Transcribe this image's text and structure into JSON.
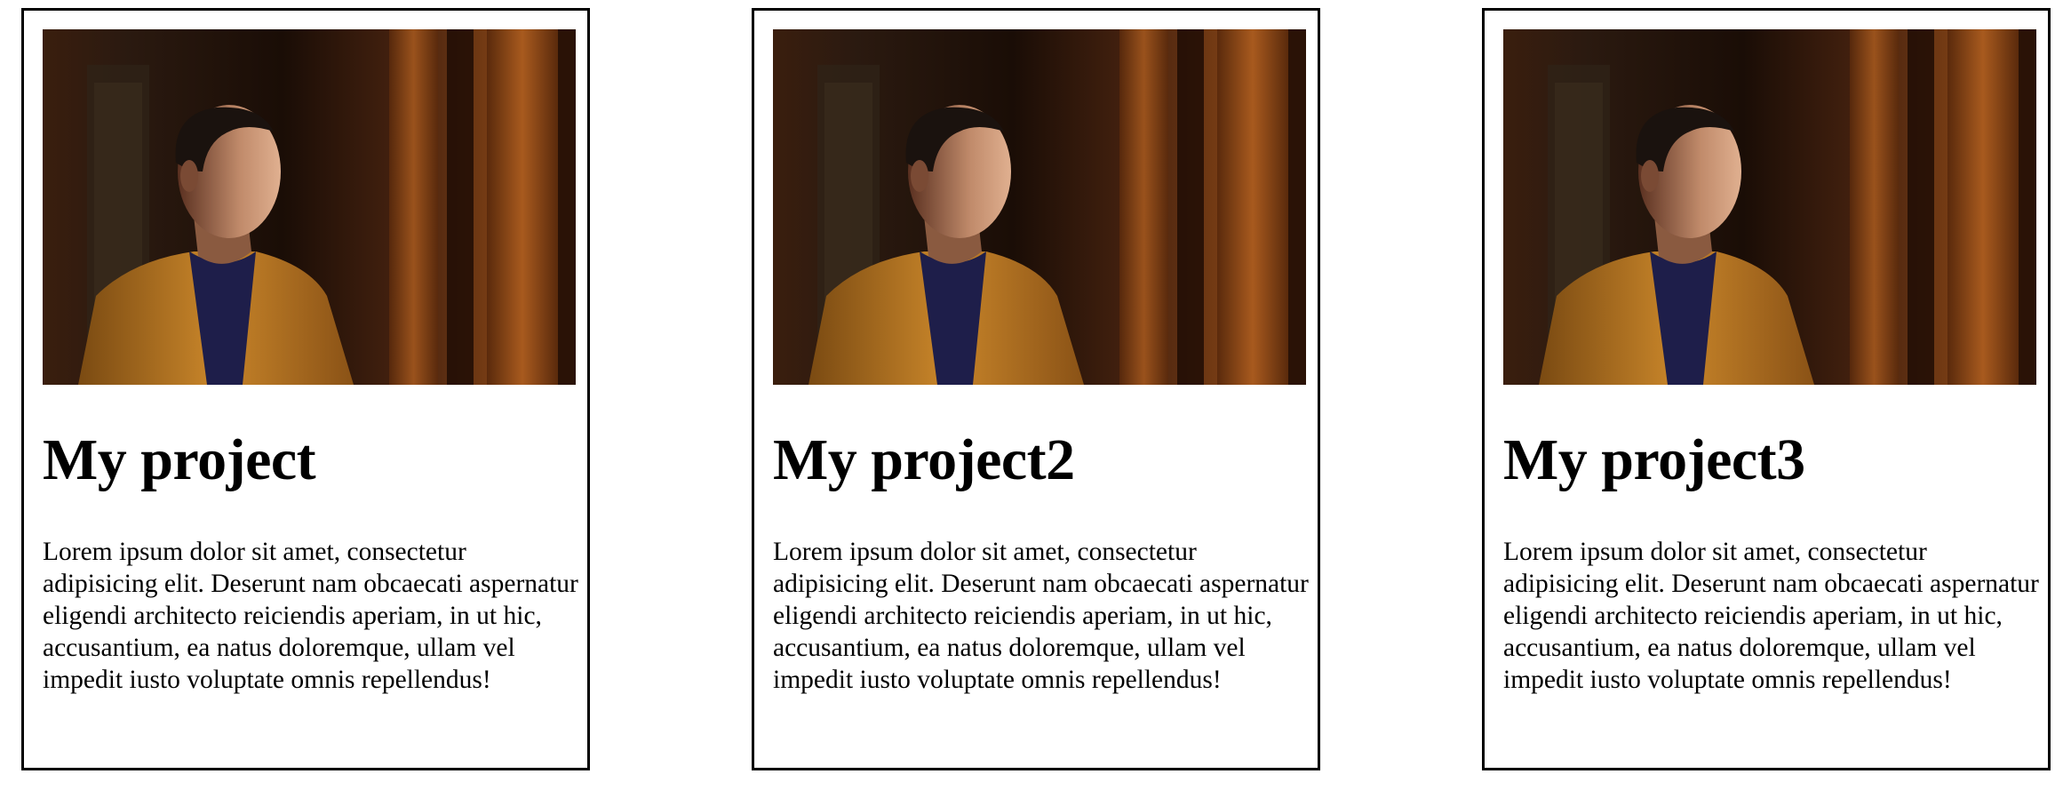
{
  "cards": [
    {
      "title": "My project",
      "description": "Lorem ipsum dolor sit amet, consectetur adipisicing elit. Deserunt nam obcaecati aspernatur eligendi architecto reiciendis aperiam, in ut hic, accusantium, ea natus doloremque, ullam vel impedit iusto voluptate omnis repellendus!"
    },
    {
      "title": "My project2",
      "description": "Lorem ipsum dolor sit amet, consectetur adipisicing elit. Deserunt nam obcaecati aspernatur eligendi architecto reiciendis aperiam, in ut hic, accusantium, ea natus doloremque, ullam vel impedit iusto voluptate omnis repellendus!"
    },
    {
      "title": "My project3",
      "description": "Lorem ipsum dolor sit amet, consectetur adipisicing elit. Deserunt nam obcaecati aspernatur eligendi architecto reiciendis aperiam, in ut hic, accusantium, ea natus doloremque, ullam vel impedit iusto voluptate omnis repellendus!"
    }
  ],
  "colors": {
    "border": "#000000",
    "background": "#ffffff",
    "text": "#000000"
  }
}
